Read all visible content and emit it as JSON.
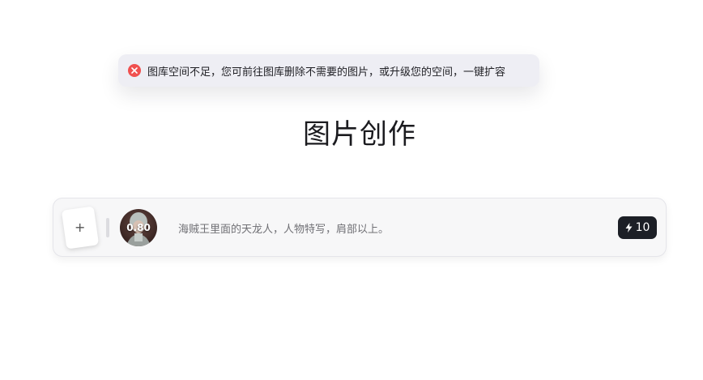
{
  "toast": {
    "message": "图库空间不足，您可前往图库删除不需要的图片，或升级您的空间，一键扩容",
    "icon": "error-circle-icon",
    "icon_color": "#f0504f"
  },
  "page": {
    "title": "图片创作"
  },
  "prompt_bar": {
    "upload_icon_label": "+",
    "reference_strength": "0.80",
    "prompt_text": "海贼王里面的天龙人，人物特写，肩部以上。",
    "credits_icon": "lightning-icon",
    "credits_value": "10"
  }
}
